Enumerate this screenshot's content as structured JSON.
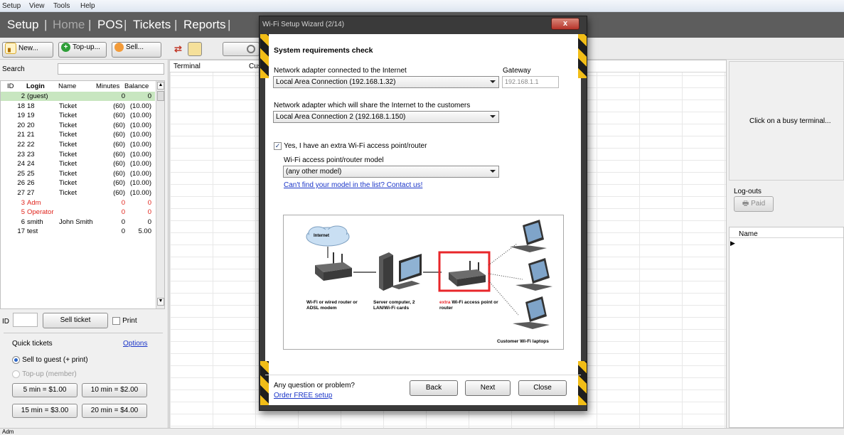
{
  "menu": {
    "items": [
      "Setup",
      "View",
      "Tools",
      "Help"
    ]
  },
  "nav": {
    "setup": "Setup",
    "home": "Home",
    "pos": "POS",
    "tickets": "Tickets",
    "reports": "Reports",
    "sep": "|"
  },
  "toolbar": {
    "new": "New...",
    "topup": "Top-up...",
    "sell": "Sell..."
  },
  "left": {
    "search_label": "Search",
    "columns": {
      "id": "ID",
      "login": "Login",
      "name": "Name",
      "minutes": "Minutes",
      "balance": "Balance"
    },
    "rows": [
      {
        "id": "2",
        "login": "(guest)",
        "name": "",
        "minutes": "0",
        "balance": "0",
        "style": "selected"
      },
      {
        "id": "18",
        "login": "18",
        "name": "Ticket",
        "minutes": "(60)",
        "balance": "(10.00)",
        "style": "normal"
      },
      {
        "id": "19",
        "login": "19",
        "name": "Ticket",
        "minutes": "(60)",
        "balance": "(10.00)",
        "style": "normal"
      },
      {
        "id": "20",
        "login": "20",
        "name": "Ticket",
        "minutes": "(60)",
        "balance": "(10.00)",
        "style": "normal"
      },
      {
        "id": "21",
        "login": "21",
        "name": "Ticket",
        "minutes": "(60)",
        "balance": "(10.00)",
        "style": "normal"
      },
      {
        "id": "22",
        "login": "22",
        "name": "Ticket",
        "minutes": "(60)",
        "balance": "(10.00)",
        "style": "normal"
      },
      {
        "id": "23",
        "login": "23",
        "name": "Ticket",
        "minutes": "(60)",
        "balance": "(10.00)",
        "style": "normal"
      },
      {
        "id": "24",
        "login": "24",
        "name": "Ticket",
        "minutes": "(60)",
        "balance": "(10.00)",
        "style": "normal"
      },
      {
        "id": "25",
        "login": "25",
        "name": "Ticket",
        "minutes": "(60)",
        "balance": "(10.00)",
        "style": "normal"
      },
      {
        "id": "26",
        "login": "26",
        "name": "Ticket",
        "minutes": "(60)",
        "balance": "(10.00)",
        "style": "normal"
      },
      {
        "id": "27",
        "login": "27",
        "name": "Ticket",
        "minutes": "(60)",
        "balance": "(10.00)",
        "style": "normal"
      },
      {
        "id": "3",
        "login": "Adm",
        "name": "",
        "minutes": "0",
        "balance": "0",
        "style": "red"
      },
      {
        "id": "5",
        "login": "Operator",
        "name": "",
        "minutes": "0",
        "balance": "0",
        "style": "red"
      },
      {
        "id": "6",
        "login": "smith",
        "name": "John Smith",
        "minutes": "0",
        "balance": "0",
        "style": "normal"
      },
      {
        "id": "17",
        "login": "test",
        "name": "",
        "minutes": "0",
        "balance": "5.00",
        "style": "normal"
      }
    ],
    "id_label": "ID",
    "sell_ticket": "Sell ticket",
    "print": "Print",
    "quick_tickets": "Quick tickets",
    "options": "Options",
    "sell_guest": "Sell to guest (+ print)",
    "topup_member": "Top-up (member)",
    "q1": "5 min = $1.00",
    "q2": "10 min = $2.00",
    "q3": "15 min = $3.00",
    "q4": "20 min = $4.00"
  },
  "terminal": {
    "col_terminal": "Terminal",
    "col_cus": "Cus"
  },
  "right": {
    "busy_hint": "Click on a busy terminal...",
    "logouts": "Log-outs",
    "paid": "Paid",
    "name_col": "Name"
  },
  "status": {
    "text": "Adm"
  },
  "dialog": {
    "title": "Wi-Fi Setup Wizard (2/14)",
    "close_x": "x",
    "heading": "System requirements check",
    "adapter_internet_label": "Network adapter connected to the Internet",
    "adapter_internet_value": "Local Area Connection (192.168.1.32)",
    "gateway_label": "Gateway",
    "gateway_value": "192.168.1.1",
    "adapter_share_label": "Network adapter which will share the Internet to the customers",
    "adapter_share_value": "Local Area Connection 2 (192.168.1.150)",
    "extra_ap_label": "Yes, I have an extra Wi-Fi access point/router",
    "model_label": "Wi-Fi access point/router model",
    "model_value": "(any other model)",
    "contact_link": "Can't find your model in the list? Contact us!",
    "diagram": {
      "internet": "Internet",
      "router": "Wi-Fi or wired router or ADSL modem",
      "server": "Server computer, 2 LAN/Wi-Fi cards",
      "extra_word": "extra",
      "extra_rest": " Wi-Fi access point or router",
      "laptops": "Customer Wi-Fi laptops"
    },
    "question": "Any question or problem?",
    "order_link": "Order FREE setup",
    "back": "Back",
    "next": "Next",
    "close": "Close"
  }
}
